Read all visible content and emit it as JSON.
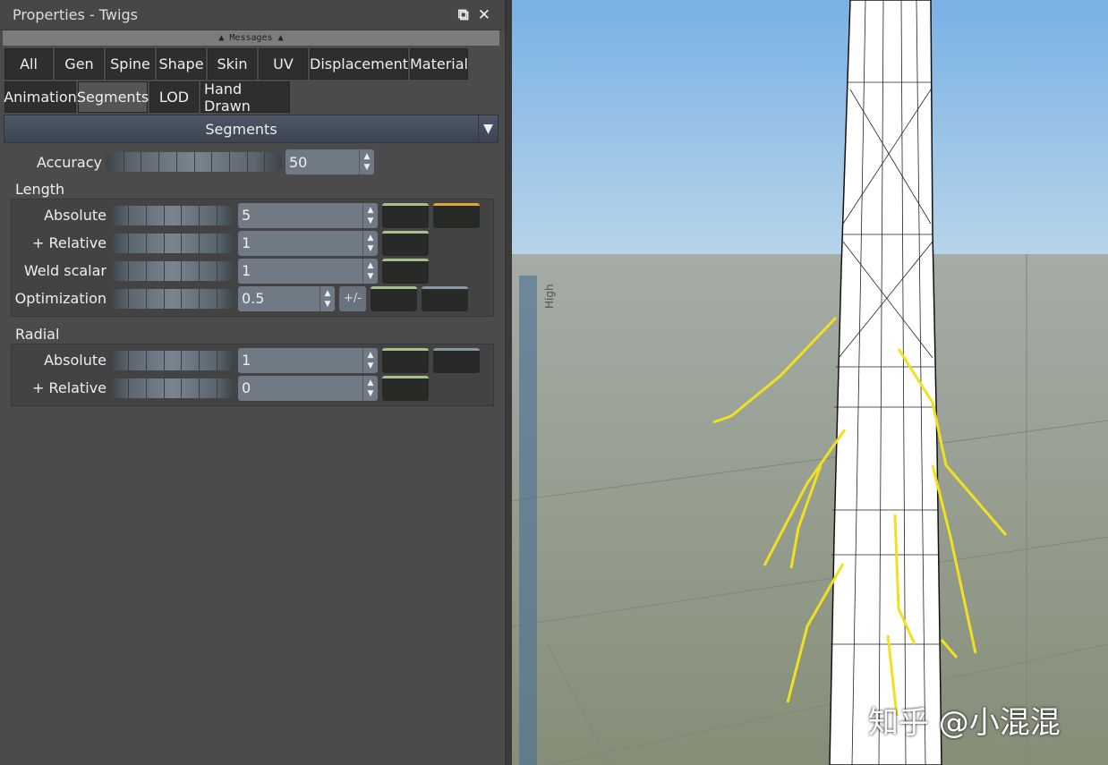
{
  "window": {
    "title": "Properties - Twigs",
    "restore_icon": "restore-icon",
    "close_icon": "close-icon"
  },
  "messages": {
    "label": "Messages"
  },
  "tabs_row1": [
    "All",
    "Gen",
    "Spine",
    "Shape",
    "Skin",
    "UV",
    "Displacement",
    "Material"
  ],
  "tabs_row2": [
    "Animation",
    "Segments",
    "LOD",
    "Hand Drawn"
  ],
  "active_tab": "Segments",
  "section": {
    "title": "Segments"
  },
  "accuracy": {
    "label": "Accuracy",
    "value": "50"
  },
  "length": {
    "title": "Length",
    "absolute": {
      "label": "Absolute",
      "value": "5"
    },
    "relative": {
      "label": "+ Relative",
      "value": "1"
    },
    "weld": {
      "label": "Weld scalar",
      "value": "1"
    },
    "optimization": {
      "label": "Optimization",
      "value": "0.5",
      "pm": "+/-"
    }
  },
  "radial": {
    "title": "Radial",
    "absolute": {
      "label": "Absolute",
      "value": "1"
    },
    "relative": {
      "label": "+ Relative",
      "value": "0"
    }
  },
  "viewport": {
    "axis_label": "High",
    "watermark": "知乎 @小混混"
  },
  "colors": {
    "wire_highlight": "#f0e020",
    "sky": "#8fc0ea",
    "ground": "#8f988c"
  }
}
